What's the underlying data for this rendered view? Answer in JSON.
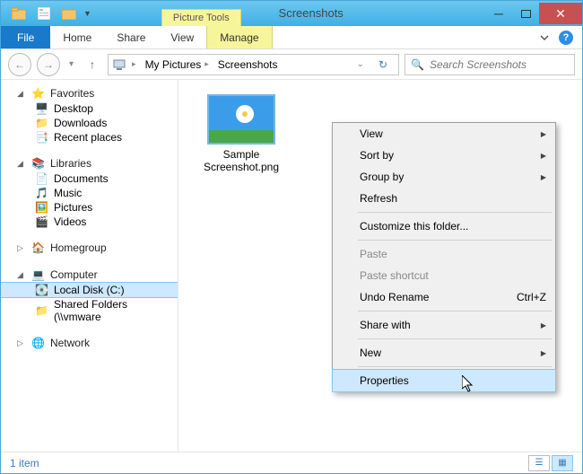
{
  "title": "Screenshots",
  "context_tab": "Picture Tools",
  "ribbon": {
    "file": "File",
    "tabs": [
      "Home",
      "Share",
      "View"
    ],
    "context": "Manage"
  },
  "breadcrumb": [
    "My Pictures",
    "Screenshots"
  ],
  "search_placeholder": "Search Screenshots",
  "sidebar": {
    "favorites": {
      "label": "Favorites",
      "items": [
        "Desktop",
        "Downloads",
        "Recent places"
      ]
    },
    "libraries": {
      "label": "Libraries",
      "items": [
        "Documents",
        "Music",
        "Pictures",
        "Videos"
      ]
    },
    "homegroup": {
      "label": "Homegroup"
    },
    "computer": {
      "label": "Computer",
      "items": [
        "Local Disk (C:)",
        "Shared Folders (\\\\vmware"
      ]
    },
    "network": {
      "label": "Network"
    }
  },
  "file": {
    "name_line1": "Sample",
    "name_line2": "Screenshot.png"
  },
  "context_menu": [
    {
      "label": "View",
      "sub": true
    },
    {
      "label": "Sort by",
      "sub": true
    },
    {
      "label": "Group by",
      "sub": true
    },
    {
      "label": "Refresh"
    },
    {
      "sep": true
    },
    {
      "label": "Customize this folder..."
    },
    {
      "sep": true
    },
    {
      "label": "Paste",
      "disabled": true
    },
    {
      "label": "Paste shortcut",
      "disabled": true
    },
    {
      "label": "Undo Rename",
      "shortcut": "Ctrl+Z"
    },
    {
      "sep": true
    },
    {
      "label": "Share with",
      "sub": true
    },
    {
      "sep": true
    },
    {
      "label": "New",
      "sub": true
    },
    {
      "sep": true
    },
    {
      "label": "Properties",
      "hover": true
    }
  ],
  "status": "1 item"
}
